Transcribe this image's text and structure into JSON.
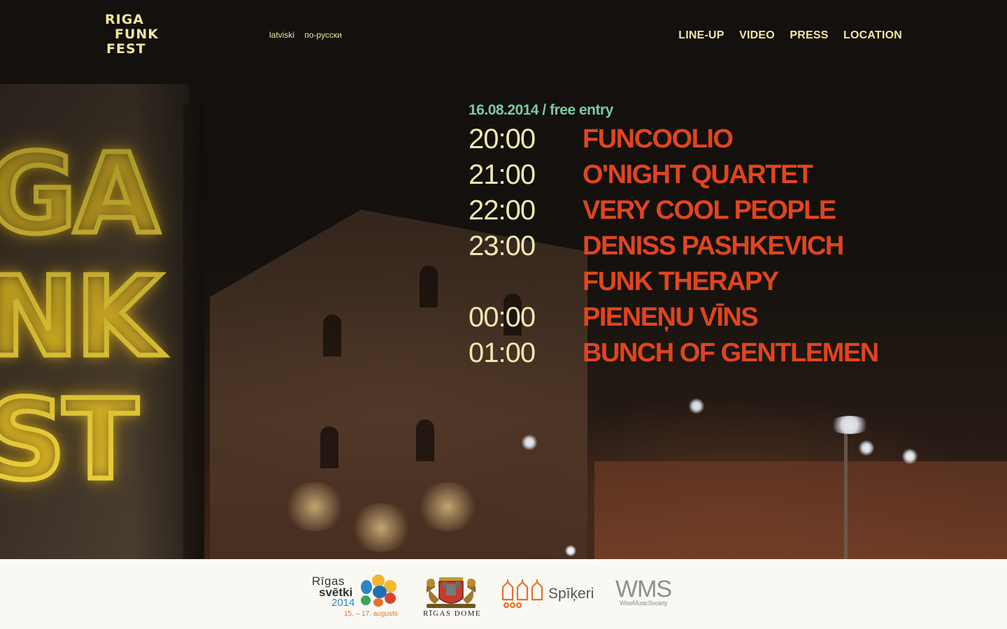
{
  "header": {
    "logo_lines": [
      "RIGA",
      "FUNK",
      "FEST"
    ],
    "languages": [
      "latviski",
      "по-русски"
    ],
    "nav": [
      "LINE-UP",
      "VIDEO",
      "PRESS",
      "LOCATION"
    ]
  },
  "hero": {
    "neon_sign_lines": [
      "GA",
      "NK",
      "ST"
    ]
  },
  "lineup": {
    "date_line": "16.08.2014 / free entry",
    "rows": [
      {
        "time": "20:00",
        "artist": "FUNCOOLIO"
      },
      {
        "time": "21:00",
        "artist": "O'NIGHT QUARTET"
      },
      {
        "time": "22:00",
        "artist": "VERY COOL PEOPLE"
      },
      {
        "time": "23:00",
        "artist": "DENISS PASHKEVICH"
      },
      {
        "time": "",
        "artist": "FUNK THERAPY"
      },
      {
        "time": "00:00",
        "artist": "PIENEŅU VĪNS"
      },
      {
        "time": "01:00",
        "artist": "BUNCH OF GENTLEMEN"
      }
    ]
  },
  "sponsors": {
    "rigas_svetki": {
      "line1": "Rīgas",
      "line2": "svētki",
      "year": "2014",
      "dates": "15. – 17. augusts"
    },
    "rigas_dome": {
      "label": "RĪGAS DOME"
    },
    "spikeri": {
      "label": "Spīķeri"
    },
    "wms": {
      "label": "WMS",
      "sub": "WiseMusicSociety"
    }
  },
  "colors": {
    "accent_text": "#f3e6a0",
    "date_green": "#7ec9a0",
    "artist_orange": "#e0451f",
    "time_cream": "#f2e7b0",
    "footer_bg": "#faf8f3"
  }
}
